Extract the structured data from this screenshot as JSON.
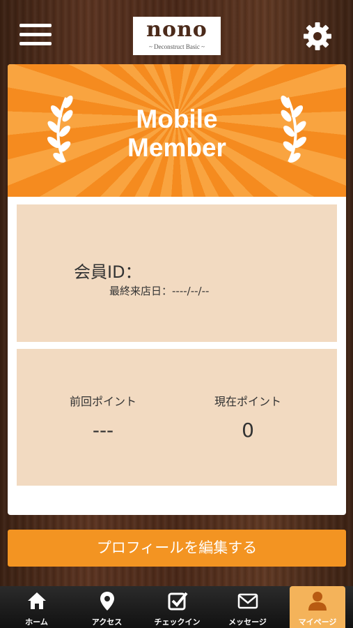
{
  "header": {
    "logo_main": "nono",
    "logo_sub": "~ Deconstruct Basic ~",
    "menu_icon": "hamburger-icon",
    "settings_icon": "gear-icon"
  },
  "card": {
    "banner_title_line1": "Mobile",
    "banner_title_line2": "Member",
    "member_id_label": "会員ID：",
    "last_visit": "最終来店日：----/--/--",
    "previous_points_label": "前回ポイント",
    "previous_points_value": "---",
    "current_points_label": "現在ポイント",
    "current_points_value": "0"
  },
  "actions": {
    "edit_profile_label": "プロフィールを編集する"
  },
  "tabs": [
    {
      "label": "ホーム",
      "icon": "home-icon"
    },
    {
      "label": "アクセス",
      "icon": "map-pin-icon"
    },
    {
      "label": "チェックイン",
      "icon": "checkbox-icon"
    },
    {
      "label": "メッセージ",
      "icon": "envelope-icon"
    },
    {
      "label": "マイページ",
      "icon": "person-icon",
      "active": true
    }
  ],
  "colors": {
    "accent": "#f39422",
    "banner": "#f58b1f",
    "panel": "#f2dac1",
    "active_tab": "#f4b35a"
  }
}
